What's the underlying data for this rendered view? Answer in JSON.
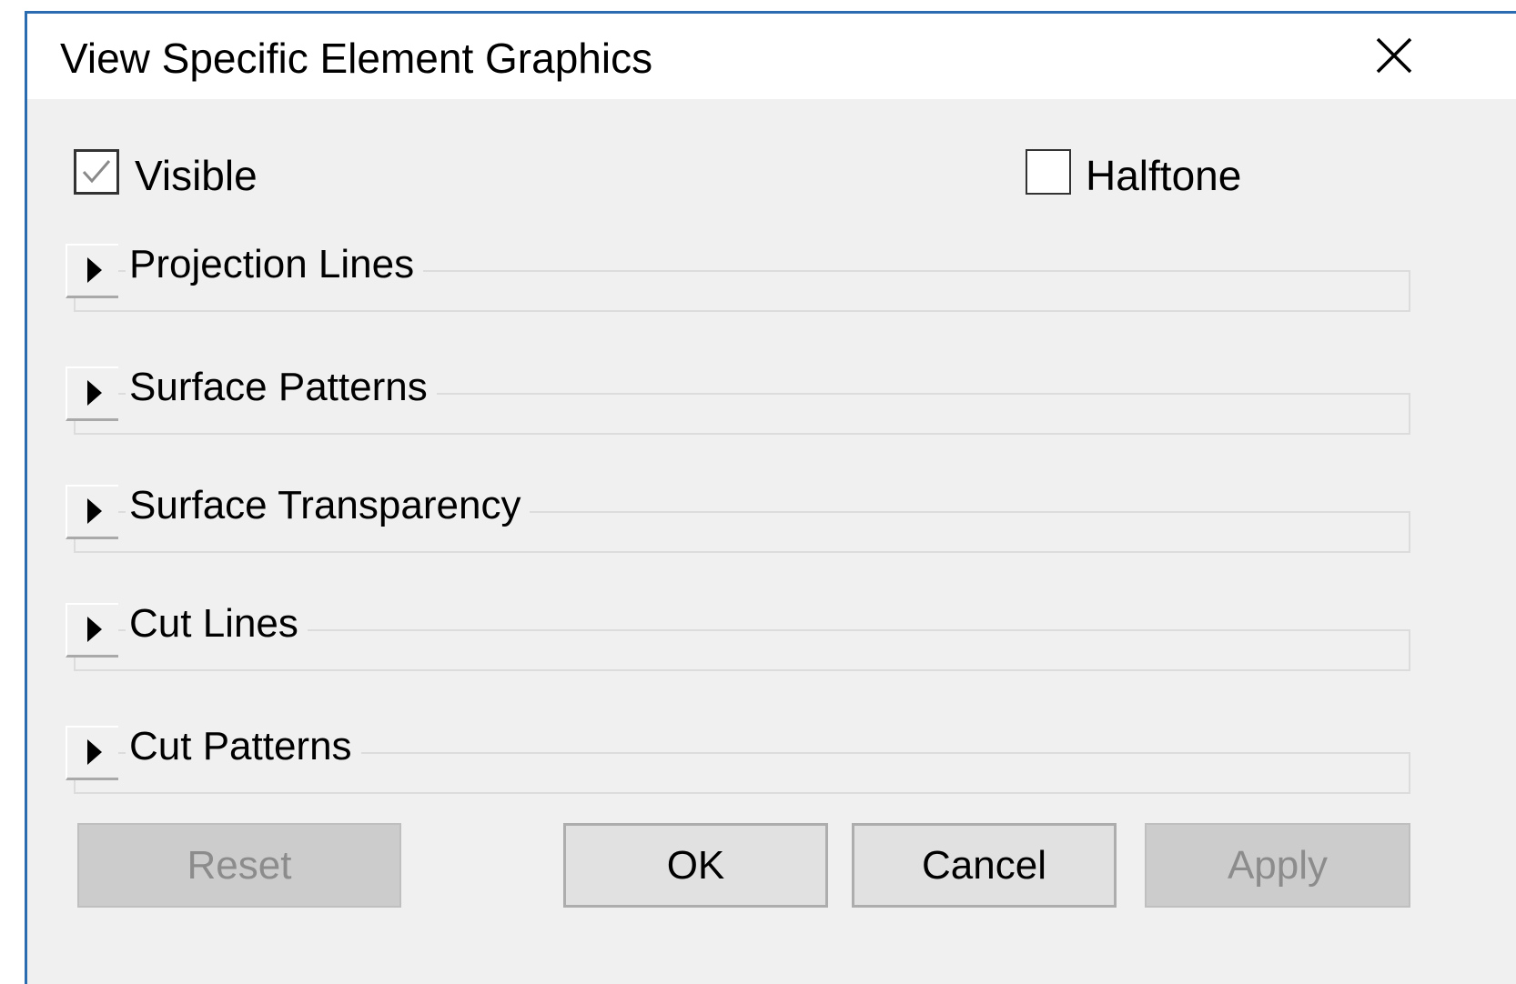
{
  "dialog": {
    "title": "View Specific Element Graphics",
    "close_icon": "close-icon"
  },
  "options": {
    "visible": {
      "label": "Visible",
      "checked": true
    },
    "halftone": {
      "label": "Halftone",
      "checked": false
    }
  },
  "sections": [
    {
      "label": "Projection Lines",
      "expanded": false
    },
    {
      "label": "Surface Patterns",
      "expanded": false
    },
    {
      "label": "Surface Transparency",
      "expanded": false
    },
    {
      "label": "Cut Lines",
      "expanded": false
    },
    {
      "label": "Cut Patterns",
      "expanded": false
    }
  ],
  "buttons": {
    "reset": {
      "label": "Reset",
      "enabled": false
    },
    "ok": {
      "label": "OK",
      "enabled": true
    },
    "cancel": {
      "label": "Cancel",
      "enabled": true
    },
    "apply": {
      "label": "Apply",
      "enabled": false
    }
  },
  "colors": {
    "dialog_border": "#2b6cb0",
    "dialog_background": "#f0f0f0",
    "title_background": "#ffffff"
  }
}
